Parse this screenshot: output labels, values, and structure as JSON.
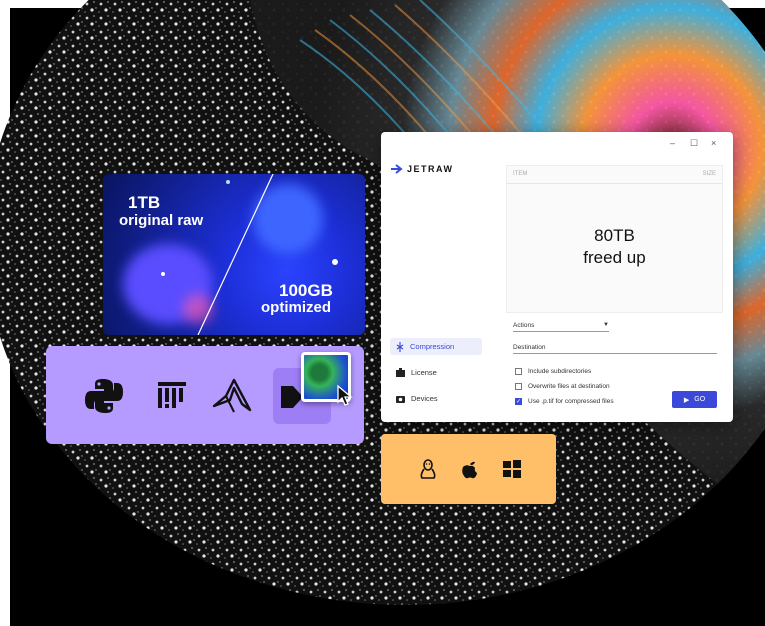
{
  "compare": {
    "raw_size": "1TB",
    "raw_label": "original raw",
    "optimized_size": "100GB",
    "optimized_label": "optimized"
  },
  "integrations": {
    "icons": [
      "python-icon",
      "fiji-icon",
      "matlab-icon",
      "plugin-icon"
    ]
  },
  "app": {
    "brand": "JETRAW",
    "window_controls": [
      "–",
      "☐",
      "×"
    ],
    "nav": [
      {
        "label": "Compression",
        "icon": "compression-icon",
        "active": true
      },
      {
        "label": "License",
        "icon": "license-icon",
        "active": false
      },
      {
        "label": "Devices",
        "icon": "camera-icon",
        "active": false
      }
    ],
    "table": {
      "col_item": "ITEM",
      "col_size": "SIZE"
    },
    "stat_line1": "80TB",
    "stat_line2": "freed up",
    "actions_label": "Actions",
    "destination_label": "Destination",
    "options": [
      {
        "label": "Include subdirectories",
        "checked": false
      },
      {
        "label": "Overwrite files at destination",
        "checked": false
      },
      {
        "label": "Use .p.tif for compressed files",
        "checked": true
      }
    ],
    "go_label": "GO"
  },
  "os": {
    "icons": [
      "linux-icon",
      "apple-icon",
      "windows-icon"
    ]
  },
  "colors": {
    "accent": "#3a49d9",
    "integrations_bg": "#b59bff",
    "os_bg": "#ffbf69",
    "card_blue": "#1d2fd8"
  }
}
